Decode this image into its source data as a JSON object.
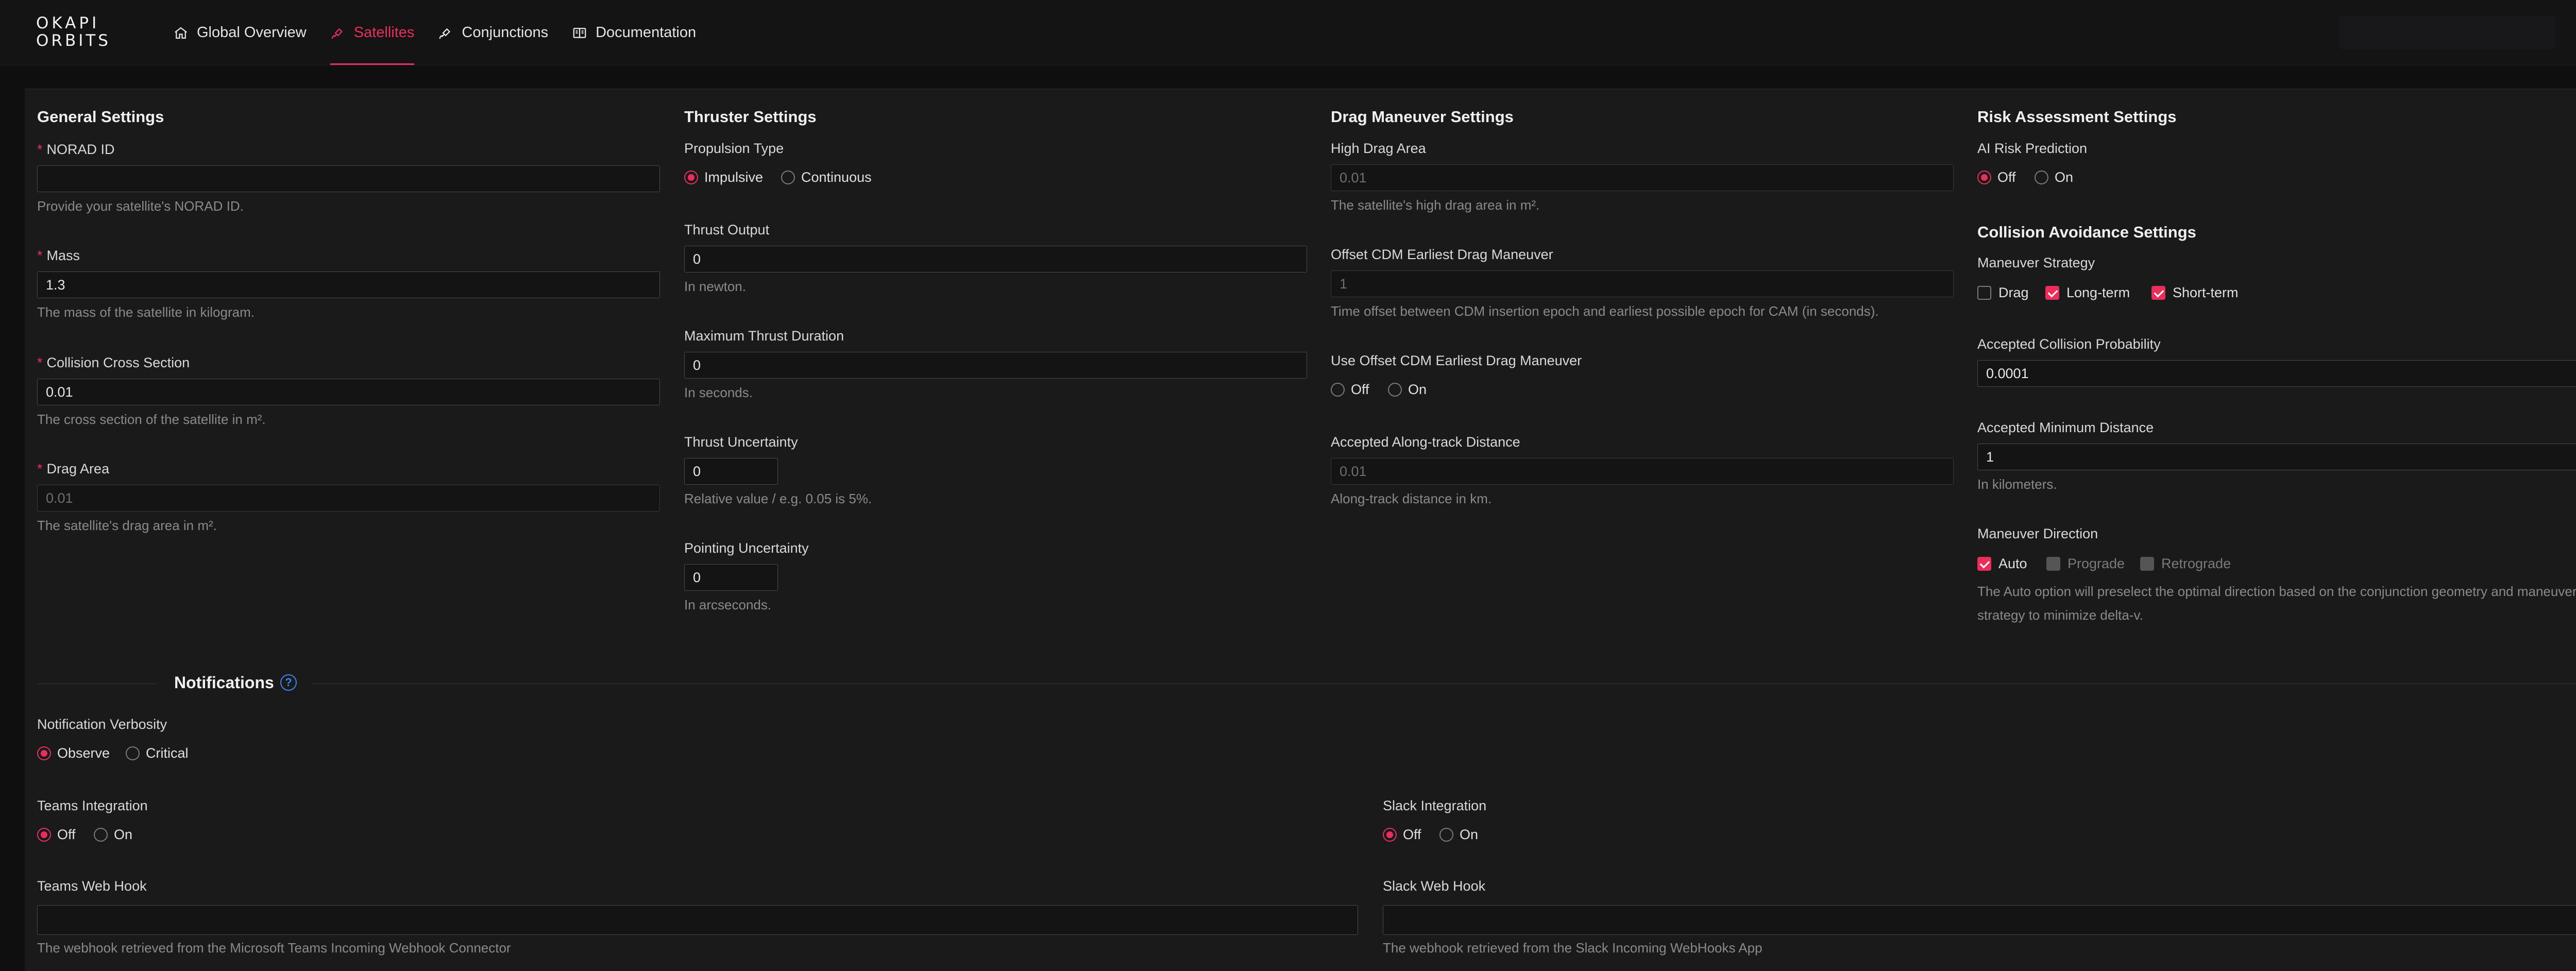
{
  "logo": {
    "line1": "OKAPI",
    "line2": "ORBITS"
  },
  "nav": {
    "items": [
      {
        "label": "Global Overview",
        "icon": "home-icon"
      },
      {
        "label": "Satellites",
        "icon": "satellite-icon",
        "active": true
      },
      {
        "label": "Conjunctions",
        "icon": "conjunction-icon"
      },
      {
        "label": "Documentation",
        "icon": "book-icon"
      }
    ]
  },
  "colors": {
    "accent": "#ea2e5c",
    "info": "#3f82f0",
    "background": "#0f0f10",
    "panel": "#1a1a1b"
  },
  "general": {
    "title": "General Settings",
    "norad": {
      "label": "NORAD ID",
      "value": "",
      "help": "Provide your satellite's NORAD ID."
    },
    "mass": {
      "label": "Mass",
      "value": "1.3",
      "help": "The mass of the satellite in kilogram."
    },
    "cross_section": {
      "label": "Collision Cross Section",
      "value": "0.01",
      "help": "The cross section of the satellite in m²."
    },
    "drag_area": {
      "label": "Drag Area",
      "placeholder": "0.01",
      "help": "The satellite's drag area in m²."
    }
  },
  "thruster": {
    "title": "Thruster Settings",
    "propulsion": {
      "label": "Propulsion Type",
      "options": [
        "Impulsive",
        "Continuous"
      ],
      "selected": "Impulsive"
    },
    "thrust_output": {
      "label": "Thrust Output",
      "value": "0",
      "help": "In newton."
    },
    "max_duration": {
      "label": "Maximum Thrust Duration",
      "value": "0",
      "help": "In seconds."
    },
    "thrust_uncertainty": {
      "label": "Thrust Uncertainty",
      "value": "0",
      "help": "Relative value / e.g. 0.05 is 5%."
    },
    "pointing_uncertainty": {
      "label": "Pointing Uncertainty",
      "value": "0",
      "help": "In arcseconds."
    }
  },
  "drag": {
    "title": "Drag Maneuver Settings",
    "high_drag_area": {
      "label": "High Drag Area",
      "placeholder": "0.01",
      "help": "The satellite's high drag area in m²."
    },
    "offset_cdm": {
      "label": "Offset CDM Earliest Drag Maneuver",
      "placeholder": "1",
      "help": "Time offset between CDM insertion epoch and earliest possible epoch for CAM (in seconds)."
    },
    "use_offset": {
      "label": "Use Offset CDM Earliest Drag Maneuver",
      "options": [
        "Off",
        "On"
      ]
    },
    "along_track": {
      "label": "Accepted Along-track Distance",
      "placeholder": "0.01",
      "help": "Along-track distance in km."
    }
  },
  "risk": {
    "title": "Risk Assessment Settings",
    "ai_prediction": {
      "label": "AI Risk Prediction",
      "options": [
        "Off",
        "On"
      ],
      "selected": "Off"
    }
  },
  "avoidance": {
    "title": "Collision Avoidance Settings",
    "strategy": {
      "label": "Maneuver Strategy",
      "options": [
        "Drag",
        "Long-term",
        "Short-term"
      ],
      "checked": [
        "Long-term",
        "Short-term"
      ]
    },
    "probability": {
      "label": "Accepted Collision Probability",
      "value": "0.0001"
    },
    "min_distance": {
      "label": "Accepted Minimum Distance",
      "value": "1",
      "help": "In kilometers."
    },
    "direction": {
      "label": "Maneuver Direction",
      "options": [
        "Auto",
        "Prograde",
        "Retrograde"
      ],
      "checked": [
        "Auto"
      ],
      "help": "The Auto option will preselect the optimal direction based on the conjunction geometry and maneuver strategy to minimize delta-v."
    }
  },
  "notifications": {
    "title": "Notifications",
    "help_glyph": "?",
    "verbosity": {
      "label": "Notification Verbosity",
      "options": [
        "Observe",
        "Critical"
      ],
      "selected": "Observe"
    },
    "teams": {
      "label": "Teams Integration",
      "options": [
        "Off",
        "On"
      ],
      "selected": "Off"
    },
    "slack": {
      "label": "Slack Integration",
      "options": [
        "Off",
        "On"
      ],
      "selected": "Off"
    },
    "teams_hook": {
      "label": "Teams Web Hook",
      "value": "",
      "help": "The webhook retrieved from the Microsoft Teams Incoming Webhook Connector"
    },
    "slack_hook": {
      "label": "Slack Web Hook",
      "value": "",
      "help": "The webhook retrieved from the Slack Incoming WebHooks App"
    }
  }
}
